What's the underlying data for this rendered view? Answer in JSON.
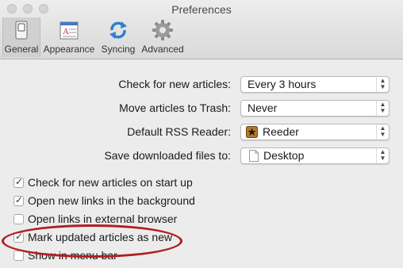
{
  "window": {
    "title": "Preferences"
  },
  "toolbar": {
    "tabs": [
      {
        "label": "General",
        "icon": "general-switch-icon",
        "active": true
      },
      {
        "label": "Appearance",
        "icon": "appearance-icon",
        "active": false
      },
      {
        "label": "Syncing",
        "icon": "sync-icon",
        "active": false
      },
      {
        "label": "Advanced",
        "icon": "gear-icon",
        "active": false
      }
    ]
  },
  "settings": {
    "check_label": "Check for new articles:",
    "check_value": "Every 3 hours",
    "trash_label": "Move articles to Trash:",
    "trash_value": "Never",
    "rss_label": "Default RSS Reader:",
    "rss_value": "Reeder",
    "save_label": "Save downloaded files to:",
    "save_value": "Desktop"
  },
  "checkboxes": [
    {
      "label": "Check for new articles on start up",
      "checked": true
    },
    {
      "label": "Open new links in the background",
      "checked": true
    },
    {
      "label": "Open links in external browser",
      "checked": false
    },
    {
      "label": "Mark updated articles as new",
      "checked": true
    },
    {
      "label": "Show in menu bar",
      "checked": false
    }
  ],
  "annotation": {
    "color": "#b01e22"
  }
}
